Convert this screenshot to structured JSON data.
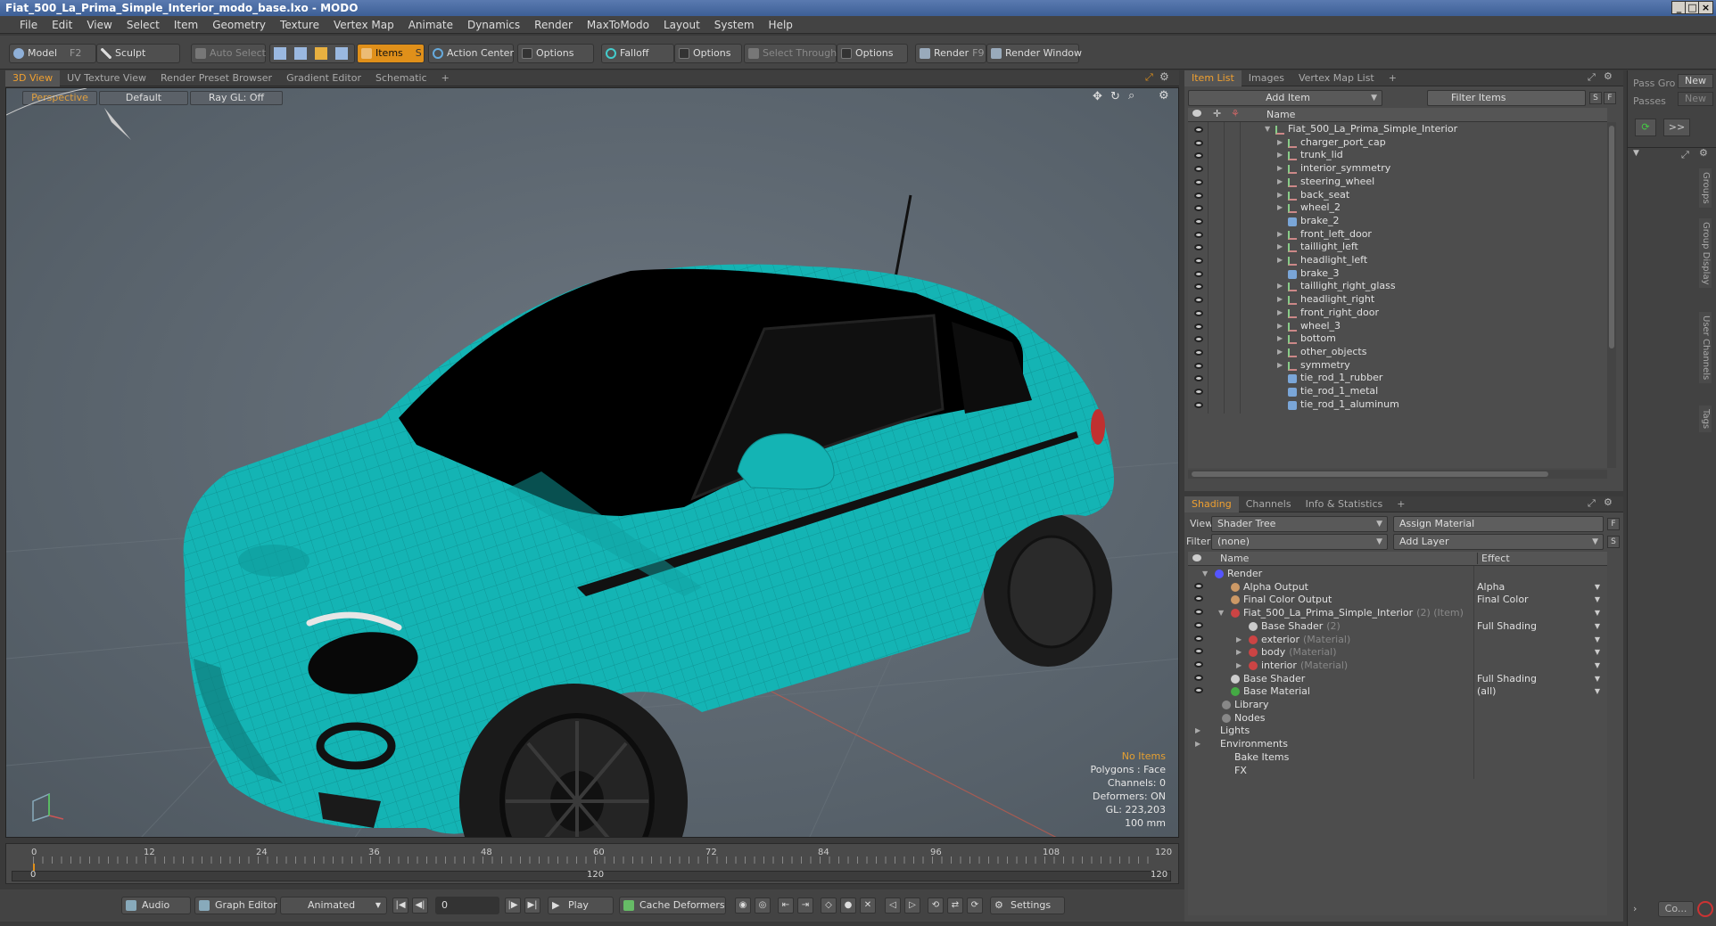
{
  "window": {
    "title": "Fiat_500_La_Prima_Simple_Interior_modo_base.lxo - MODO"
  },
  "menu": [
    "File",
    "Edit",
    "View",
    "Select",
    "Item",
    "Geometry",
    "Texture",
    "Vertex Map",
    "Animate",
    "Dynamics",
    "Render",
    "MaxToModo",
    "Layout",
    "System",
    "Help"
  ],
  "toolbar": {
    "model": "Model",
    "model_key": "F2",
    "sculpt": "Sculpt",
    "auto_select": "Auto Select",
    "items": "Items",
    "items_key": "S",
    "action_center": "Action Center",
    "options1": "Options",
    "falloff": "Falloff",
    "options2": "Options",
    "select_through": "Select Through",
    "options3": "Options",
    "render": "Render",
    "render_key": "F9",
    "render_window": "Render Window"
  },
  "view_tabs": [
    "3D View",
    "UV Texture View",
    "Render Preset Browser",
    "Gradient Editor",
    "Schematic",
    "+"
  ],
  "viewport": {
    "perspective": "Perspective",
    "default": "Default",
    "raygl": "Ray GL: Off",
    "info": {
      "items": "No Items",
      "polygons": "Polygons : Face",
      "channels": "Channels: 0",
      "deformers": "Deformers: ON",
      "gl": "GL: 223,203",
      "scale": "100 mm"
    }
  },
  "timeline": {
    "ticks_top": [
      "0",
      "12",
      "24",
      "36",
      "48",
      "60",
      "72",
      "84",
      "96",
      "108",
      "120"
    ],
    "start": "0",
    "mid": "120",
    "end": "120"
  },
  "bottom": {
    "audio": "Audio",
    "graph_editor": "Graph Editor",
    "animated": "Animated",
    "frame": "0",
    "play": "Play",
    "cache_deformers": "Cache Deformers",
    "settings": "Settings"
  },
  "item_panel": {
    "tabs": [
      "Item List",
      "Images",
      "Vertex Map List",
      "+"
    ],
    "add_item": "Add Item",
    "filter": "Filter Items",
    "col_name": "Name",
    "root": "Fiat_500_La_Prima_Simple_Interior",
    "items": [
      {
        "name": "charger_port_cap",
        "type": "group"
      },
      {
        "name": "trunk_lid",
        "type": "group"
      },
      {
        "name": "interior_symmetry",
        "type": "group"
      },
      {
        "name": "steering_wheel",
        "type": "group"
      },
      {
        "name": "back_seat",
        "type": "group"
      },
      {
        "name": "wheel_2",
        "type": "group"
      },
      {
        "name": "brake_2",
        "type": "mesh"
      },
      {
        "name": "front_left_door",
        "type": "group"
      },
      {
        "name": "taillight_left",
        "type": "group"
      },
      {
        "name": "headlight_left",
        "type": "group"
      },
      {
        "name": "brake_3",
        "type": "mesh"
      },
      {
        "name": "taillight_right_glass",
        "type": "group"
      },
      {
        "name": "headlight_right",
        "type": "group"
      },
      {
        "name": "front_right_door",
        "type": "group"
      },
      {
        "name": "wheel_3",
        "type": "group"
      },
      {
        "name": "bottom",
        "type": "group"
      },
      {
        "name": "other_objects",
        "type": "group"
      },
      {
        "name": "symmetry",
        "type": "group"
      },
      {
        "name": "tie_rod_1_rubber",
        "type": "mesh"
      },
      {
        "name": "tie_rod_1_metal",
        "type": "mesh"
      },
      {
        "name": "tie_rod_1_aluminum",
        "type": "mesh"
      }
    ]
  },
  "shading_panel": {
    "tabs": [
      "Shading",
      "Channels",
      "Info & Statistics",
      "+"
    ],
    "view_label": "View",
    "view_value": "Shader Tree",
    "assign_material": "Assign Material",
    "filter_label": "Filter",
    "filter_value": "(none)",
    "add_layer": "Add Layer",
    "col_name": "Name",
    "col_effect": "Effect",
    "rows": [
      {
        "name": "Render",
        "extra": "",
        "effect": "",
        "eye": false
      },
      {
        "name": "Alpha Output",
        "extra": "",
        "effect": "Alpha",
        "eye": true
      },
      {
        "name": "Final Color Output",
        "extra": "",
        "effect": "Final Color",
        "eye": true
      },
      {
        "name": "Fiat_500_La_Prima_Simple_Interior",
        "extra": "(2) (Item)",
        "effect": "",
        "eye": true
      },
      {
        "name": "Base Shader",
        "extra": "(2)",
        "effect": "Full Shading",
        "eye": true
      },
      {
        "name": "exterior",
        "extra": "(Material)",
        "effect": "",
        "eye": true
      },
      {
        "name": "body",
        "extra": "(Material)",
        "effect": "",
        "eye": true
      },
      {
        "name": "interior",
        "extra": "(Material)",
        "effect": "",
        "eye": true
      },
      {
        "name": "Base Shader",
        "extra": "",
        "effect": "Full Shading",
        "eye": true
      },
      {
        "name": "Base Material",
        "extra": "",
        "effect": "(all)",
        "eye": true
      },
      {
        "name": "Library",
        "extra": "",
        "effect": "",
        "eye": false
      },
      {
        "name": "Nodes",
        "extra": "",
        "effect": "",
        "eye": false
      },
      {
        "name": "Lights",
        "extra": "",
        "effect": "",
        "eye": false
      },
      {
        "name": "Environments",
        "extra": "",
        "effect": "",
        "eye": false
      },
      {
        "name": "Bake Items",
        "extra": "",
        "effect": "",
        "eye": false
      },
      {
        "name": "FX",
        "extra": "",
        "effect": "",
        "eye": false
      }
    ]
  },
  "side": {
    "pass_group": "Pass Gro",
    "passes": "Passes",
    "new1": "New",
    "new2": "New",
    "vtabs": [
      "Groups",
      "Group Display",
      "User Channels",
      "Tags"
    ],
    "command": "Co..."
  },
  "colors": {
    "accent": "#e0901a",
    "car": "#14b4b4"
  }
}
